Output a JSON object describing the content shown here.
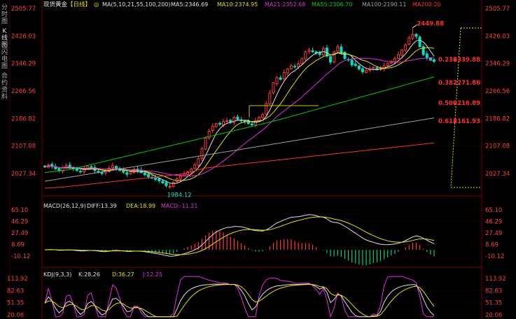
{
  "sidebar": {
    "tabs": [
      "分时图",
      "K线图",
      "闪电图",
      "合约资料"
    ]
  },
  "main_panel": {
    "title": "现货黄金",
    "period": "【日线】",
    "settings_glyph": "◎",
    "ma_legend": [
      {
        "label": "MA(5,10,21,55,100,200)",
        "color": "#e0e0e0"
      },
      {
        "label": "MA5:2346.69",
        "color": "#e0e0e0"
      },
      {
        "label": "MA10:2374.95",
        "color": "#e8e000"
      },
      {
        "label": "MA21:2352.68",
        "color": "#e030e0"
      },
      {
        "label": "MA55:2306.70",
        "color": "#00d000"
      },
      {
        "label": "MA100:2190.11",
        "color": "#a0a0a0"
      },
      {
        "label": "MA200:20",
        "color": "#ff3030"
      }
    ],
    "y_ticks_left": [
      "2505.77",
      "2426.03",
      "2346.29",
      "2266.56",
      "2186.82",
      "2107.08",
      "2027.34"
    ],
    "y_ticks_right": [
      "2505.77",
      "2426.03",
      "2346.29",
      "2266.56",
      "2186.82",
      "2107.08",
      "2027.34"
    ],
    "high_label": "2449.88",
    "low_label": "1984.12",
    "fib_levels": [
      {
        "label": "0.236",
        "value_label": "2339.88"
      },
      {
        "label": "0.382",
        "value_label": "2271.86"
      },
      {
        "label": "0.500",
        "value_label": "2216.89"
      },
      {
        "label": "0.618",
        "value_label": "2161.93"
      }
    ]
  },
  "macd_panel": {
    "legend": [
      {
        "label": "MACD(26,12,9)",
        "color": "#e0e0e0"
      },
      {
        "label": "DIFF:13.39",
        "color": "#e0e0e0"
      },
      {
        "label": "DEA:18.99",
        "color": "#e8e000"
      },
      {
        "label": "MACD:-11.21",
        "color": "#e030e0"
      }
    ],
    "y_ticks_left": [
      "65.10",
      "46.29",
      "27.49",
      "8.69",
      "-10.12"
    ],
    "y_ticks_right": [
      "65.10",
      "46.29",
      "27.49",
      "8.69",
      "-10.12"
    ]
  },
  "kdj_panel": {
    "legend": [
      {
        "label": "KDJ(9,3,3)",
        "color": "#e0e0e0"
      },
      {
        "label": "K:28.26",
        "color": "#e0e0e0"
      },
      {
        "label": "D:36.27",
        "color": "#e8e000"
      },
      {
        "label": "J:12.25",
        "color": "#e030e0"
      }
    ],
    "y_ticks_left": [
      "113.92",
      "82.63",
      "51.35",
      "20.06"
    ],
    "y_ticks_right": [
      "113.92",
      "82.63",
      "51.35",
      "20.06"
    ]
  },
  "colors": {
    "up": "#ff3b3b",
    "down": "#00e0c0",
    "background": "#000000",
    "grid": "#5a0000",
    "axis_text": "#ff4040"
  },
  "chart_data": {
    "type": "candlestick",
    "instrument": "现货黄金",
    "period": "日线",
    "ylim": [
      2027.34,
      2505.77
    ],
    "high": 2449.88,
    "low": 1984.12,
    "fib_retracement": [
      {
        "ratio": 0.236,
        "price": 2339.88
      },
      {
        "ratio": 0.382,
        "price": 2271.86
      },
      {
        "ratio": 0.5,
        "price": 2216.89
      },
      {
        "ratio": 0.618,
        "price": 2161.93
      }
    ],
    "moving_averages": {
      "MA5": 2346.69,
      "MA10": 2374.95,
      "MA21": 2352.68,
      "MA55": 2306.7,
      "MA100": 2190.11
    },
    "macd": {
      "DIFF": 13.39,
      "DEA": 18.99,
      "MACD": -11.21
    },
    "kdj": {
      "K": 28.26,
      "D": 36.27,
      "J": 12.25
    },
    "close_path": [
      2046,
      2052,
      2048,
      2041,
      2036,
      2044,
      2050,
      2046,
      2041,
      2036,
      2032,
      2040,
      2048,
      2044,
      2036,
      2031,
      2027,
      2034,
      2043,
      2050,
      2042,
      2036,
      2031,
      2025,
      2033,
      2040,
      2035,
      2030,
      2024,
      2018,
      2014,
      2010,
      2006,
      2000,
      1992,
      1990,
      2002,
      2012,
      2020,
      2026,
      2032,
      2040,
      2052,
      2070,
      2100,
      2130,
      2150,
      2164,
      2172,
      2170,
      2178,
      2180,
      2176,
      2190,
      2184,
      2180,
      2178,
      2172,
      2168,
      2180,
      2190,
      2198,
      2230,
      2260,
      2290,
      2305,
      2300,
      2320,
      2330,
      2340,
      2336,
      2345,
      2360,
      2380,
      2385,
      2380,
      2376,
      2372,
      2390,
      2368,
      2350,
      2380,
      2395,
      2378,
      2360,
      2356,
      2342,
      2340,
      2330,
      2322,
      2326,
      2330,
      2335,
      2328,
      2332,
      2340,
      2346,
      2352,
      2360,
      2372,
      2385,
      2400,
      2420,
      2430,
      2425,
      2395,
      2372,
      2362,
      2356,
      2352
    ]
  }
}
